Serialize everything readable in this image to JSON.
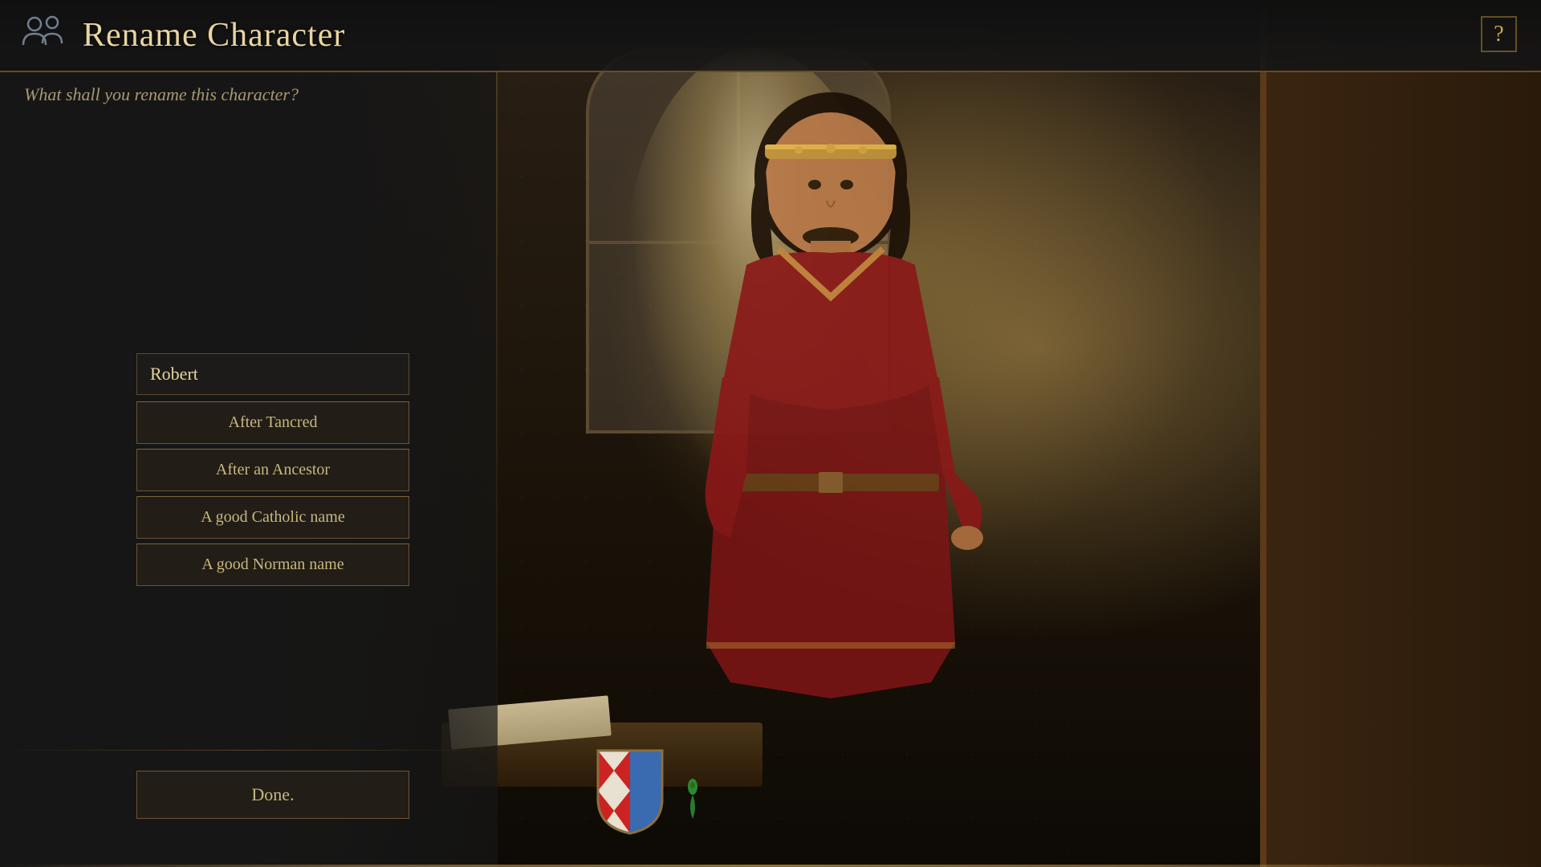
{
  "header": {
    "title": "Rename Character",
    "icon": "people-icon",
    "help_label": "?"
  },
  "subtitle": "What shall you rename this character?",
  "name_input": {
    "value": "Robert",
    "placeholder": "Robert"
  },
  "options": [
    {
      "id": "after-tancred",
      "label": "After Tancred"
    },
    {
      "id": "after-ancestor",
      "label": "After an Ancestor"
    },
    {
      "id": "catholic-name",
      "label": "A good Catholic name"
    },
    {
      "id": "norman-name",
      "label": "A good Norman name"
    }
  ],
  "done_button": {
    "label": "Done."
  },
  "colors": {
    "accent": "#c8a855",
    "panel_bg": "#161614",
    "text_primary": "#e8d5a0",
    "text_secondary": "#a89870",
    "border": "#6a5535"
  }
}
